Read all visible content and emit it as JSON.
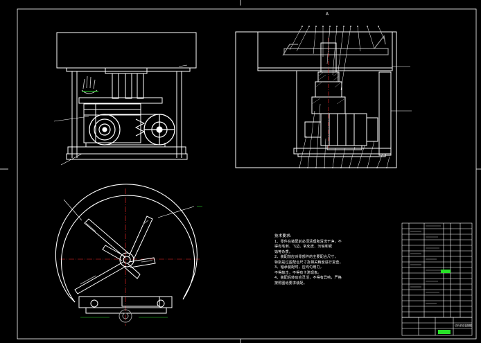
{
  "drawing": {
    "colors": {
      "background": "#000000",
      "line": "#ffffff",
      "center": "#ff2a2a",
      "dim": "#28e028",
      "part": "#9a9a9a",
      "frame": "#ffffff"
    },
    "section_mark": "A",
    "notes": {
      "title": "技术要求:",
      "lines": [
        "1、零件在装配前必须清理和清洗干净，不",
        "得有毛刺、飞边、氧化皮、污垢和锈",
        "蚀等杂质。",
        "2、装配前应对零部件的主要配合尺寸，",
        "特别是过盈配合尺寸及相关精度进行复查。",
        "3、轴承装配时，应均匀用力，",
        "不得敲击，不得有卡滞现象。",
        "4、装配后转动应灵活，不得有异响，严格",
        "按照图纸要求装配。"
      ]
    },
    "title_block": {
      "title": "切片机总装配图"
    }
  }
}
